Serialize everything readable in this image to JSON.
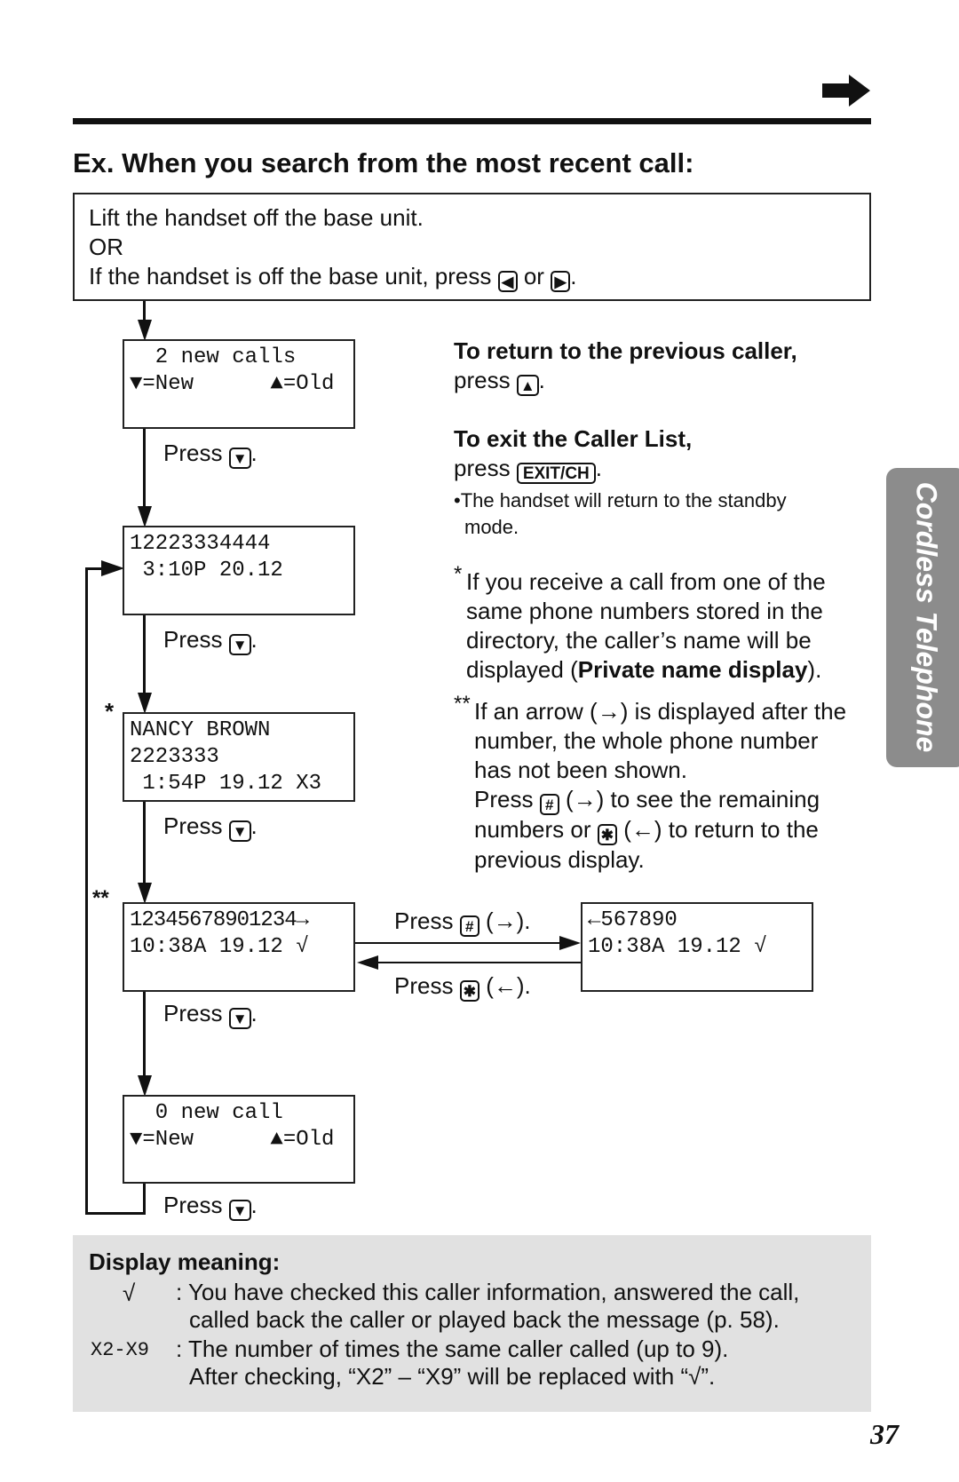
{
  "heading": "Ex. When you search from the most recent call:",
  "start_box": {
    "line1": "Lift the handset off the base unit.",
    "line2": "OR",
    "line3_pre": "If the handset is off the base unit, press",
    "line3_or": "or",
    "key_left": "◀",
    "key_right": "▶"
  },
  "screens": [
    {
      "lines": [
        "",
        "  2 new calls",
        "▼=New      ▲=Old"
      ]
    },
    {
      "lines": [
        "",
        "12223334444",
        " 3:10P 20.12"
      ]
    },
    {
      "marker": "*",
      "lines": [
        "NANCY BROWN",
        "2223333",
        " 1:54P 19.12 X3"
      ]
    },
    {
      "marker": "**",
      "lines": [
        "",
        "12345678901234→",
        "10:38A 19.12 √"
      ]
    },
    {
      "lines": [
        "",
        "  0 new call",
        "▼=New      ▲=Old"
      ]
    }
  ],
  "side_screen": {
    "lines": [
      "",
      "←567890",
      "10:38A 19.12 √"
    ]
  },
  "press_label": "Press",
  "key_down": "▼",
  "key_up": "▲",
  "key_hash": "#",
  "key_star": "✱",
  "hash_caption": "(→).",
  "star_caption": "(←).",
  "right_notes": {
    "return_title": "To return to the previous caller,",
    "return_press": "press",
    "exit_title": "To exit the Caller List,",
    "exit_press": "press",
    "exit_key": "EXIT/CH",
    "bullet": "•The handset will return to the standby",
    "bullet2": "mode.",
    "note1_mark": "*",
    "note1": [
      "If you receive a call from one of the",
      "same phone numbers stored in the",
      "directory, the caller’s name will be"
    ],
    "note1_last_pre": "displayed (",
    "note1_bold": "Private name display",
    "note1_last_post": ").",
    "note2_mark": "**",
    "note2": [
      "If an arrow (→) is displayed after the",
      "number, the whole phone number",
      "has not been shown."
    ],
    "note2_press": "Press",
    "note2_hash_post": "(→) to see the remaining",
    "note2_line5_pre": "numbers or",
    "note2_star_post": "(←) to return to the",
    "note2_last": "previous display."
  },
  "side_tab": "Cordless Telephone",
  "display_meaning": {
    "title": "Display meaning:",
    "sym1": "√",
    "desc1": [
      ": You have checked this caller information, answered the call,",
      "called back the caller or played back the message (p. 58)."
    ],
    "sym2": "X2-X9",
    "desc2": [
      ": The number of times the same caller called (up to 9).",
      "After checking, “X2” – “X9” will be replaced with “√”."
    ]
  },
  "page_number": "37",
  "colors": {
    "gray_box": "#e1e1e1",
    "side_tab": "#8c8c8c"
  }
}
